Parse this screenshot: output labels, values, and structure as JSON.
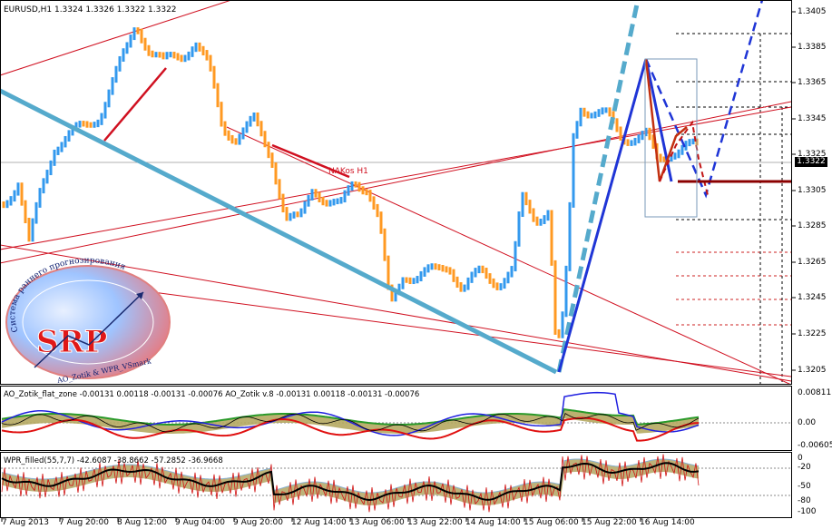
{
  "main_chart": {
    "title": "EURUSD,H1  1.3324 1.3326 1.3322 1.3322",
    "drawing_label": "NAKos H1",
    "current_price": "1.3322",
    "price_labels": [
      "1.3405",
      "1.3385",
      "1.3365",
      "1.3345",
      "1.3325",
      "1.3305",
      "1.3285",
      "1.3265",
      "1.3245",
      "1.3225",
      "1.3205"
    ]
  },
  "indicator_ao": {
    "title": "AO_Zotik_flat_zone -0.00131 0.00118 -0.00131 -0.00076  AO_Zotik v.8 -0.00131 0.00118 -0.00131 -0.00076",
    "scale_labels": [
      "0.00811",
      "0.00",
      "-0.00605"
    ]
  },
  "indicator_wpr": {
    "title": "WPR_filled(55,7,7) -42.6087 -38.8662 -57.2852 -36.9668",
    "scale_labels": [
      "0",
      "-20",
      "-50",
      "-80",
      "-100"
    ]
  },
  "logo": {
    "main": "SRP",
    "arc_text": "Система раннего прогнозирования",
    "sub_text": "AO_Zotik & WPR_VSmark"
  },
  "time_axis": [
    "7 Aug 2013",
    "7 Aug 20:00",
    "8 Aug 12:00",
    "9 Aug 04:00",
    "9 Aug 20:00",
    "12 Aug 14:00",
    "13 Aug 06:00",
    "13 Aug 22:00",
    "14 Aug 14:00",
    "15 Aug 06:00",
    "15 Aug 22:00",
    "16 Aug 14:00"
  ],
  "colors": {
    "bull_bar": "#3399ee",
    "bear_bar": "#ff9922",
    "channel_line": "#55aacc",
    "trend_blue": "#1f35d6",
    "trend_red": "#d01020",
    "forecast_dark_red": "#8b0000"
  }
}
